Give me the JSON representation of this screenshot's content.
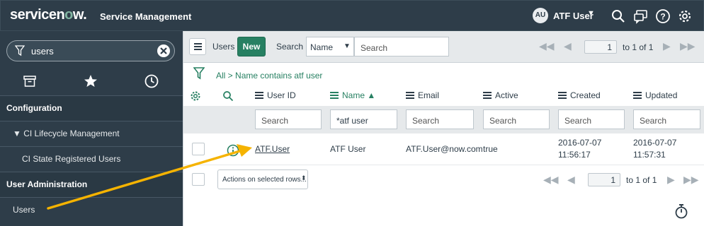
{
  "banner": {
    "logo_prefix": "servicen",
    "logo_o": "o",
    "logo_suffix": "w.",
    "product": "Service Management",
    "avatar_initials": "AU",
    "user_name": "ATF User",
    "icons": [
      "search-icon",
      "chat-icon",
      "help-icon",
      "gear-icon"
    ]
  },
  "nav": {
    "filter_value": "users",
    "tabs": [
      "archive-icon",
      "star-icon",
      "clock-icon"
    ],
    "items": [
      {
        "label": "Configuration",
        "section": true
      },
      {
        "label": "▼ CI Lifecycle Management",
        "section": false
      },
      {
        "label": "CI State Registered Users",
        "section": false
      },
      {
        "label": "User Administration",
        "section": true
      },
      {
        "label": "Users",
        "section": false
      }
    ]
  },
  "toolbar": {
    "title": "Users",
    "new_label": "New",
    "search_label": "Search",
    "search_field": "Name",
    "search_placeholder": "Search",
    "page_value": "1",
    "page_text": "to 1 of 1"
  },
  "breadcrumb": {
    "all": "All",
    "separator": " > ",
    "condition": "Name contains atf user"
  },
  "columns": [
    {
      "label": "User ID",
      "search": "Search"
    },
    {
      "label": "Name ▲",
      "search": "*atf user",
      "sorted": true
    },
    {
      "label": "Email",
      "search": "Search"
    },
    {
      "label": "Active",
      "search": "Search"
    },
    {
      "label": "Created",
      "search": "Search"
    },
    {
      "label": "Updated",
      "search": "Search"
    }
  ],
  "rows": [
    {
      "user_id": "ATF.User",
      "name": "ATF User",
      "email": "ATF.User@now.com",
      "active": "true",
      "created_date": "2016-07-07",
      "created_time": "11:56:17",
      "updated_date": "2016-07-07",
      "updated_time": "11:57:31"
    }
  ],
  "footer": {
    "actions_label": "Actions on selected rows...",
    "page_value": "1",
    "page_text": "to 1 of 1"
  },
  "colors": {
    "banner_bg": "#2e3d49",
    "accent_green": "#278062",
    "annotation_arrow": "#f5b300"
  }
}
